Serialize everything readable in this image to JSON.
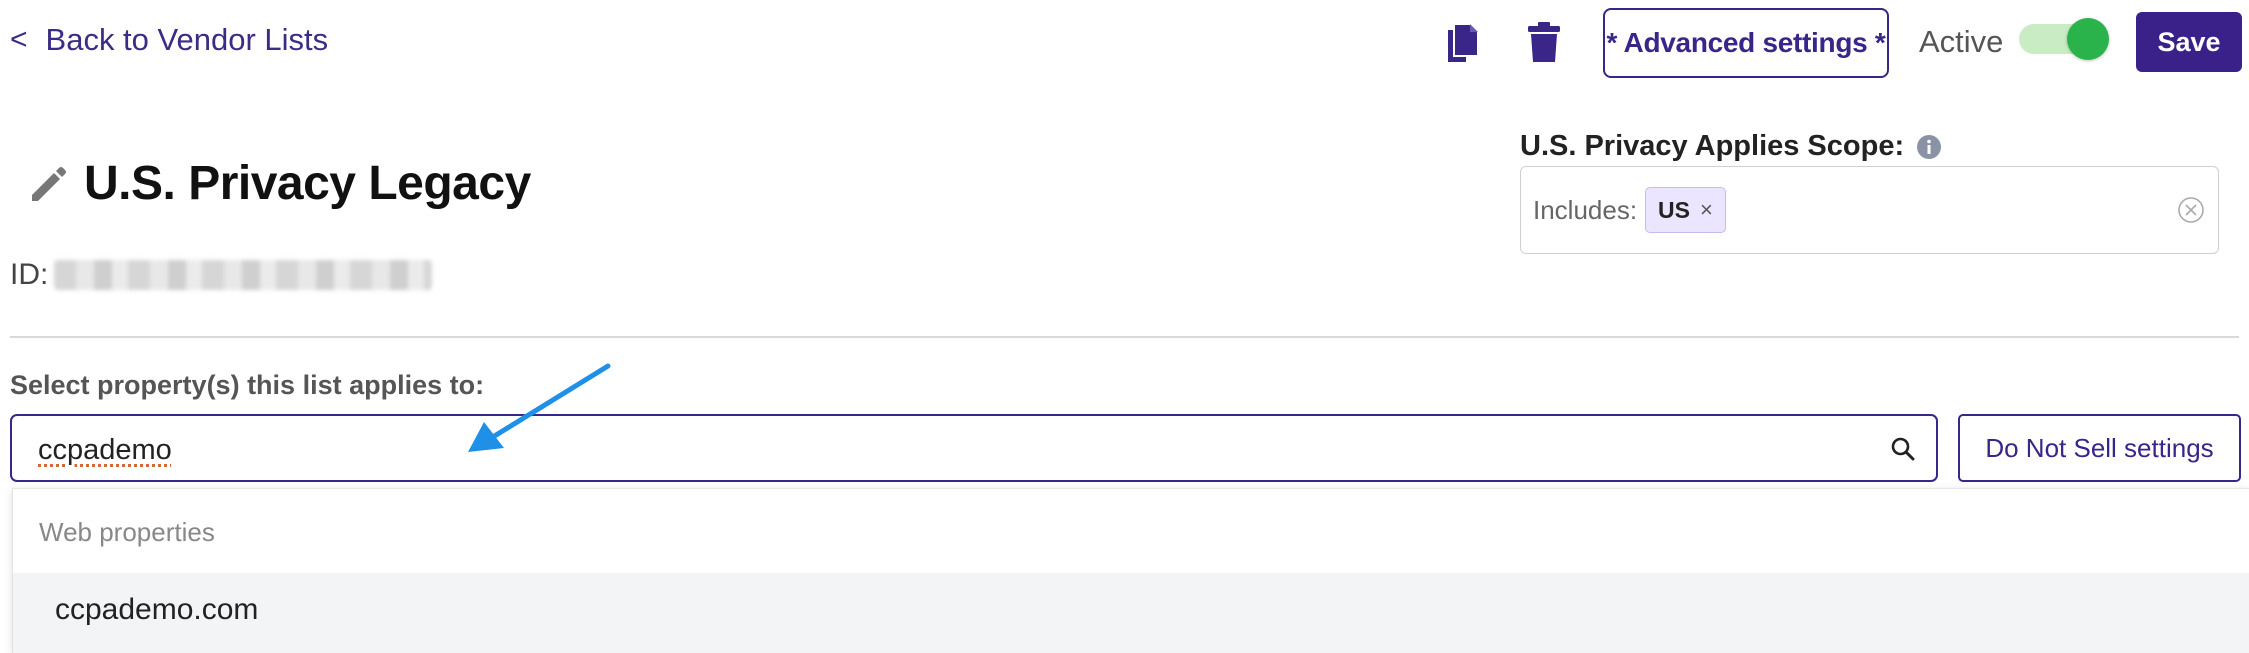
{
  "header": {
    "back_chevron": "<",
    "back_label": "Back to Vendor Lists",
    "copy_icon": "copy-icon",
    "trash_icon": "trash-icon",
    "advanced_settings_label": "* Advanced settings *",
    "active_label": "Active",
    "active_on": true,
    "save_label": "Save"
  },
  "title": {
    "icon": "pencil-icon",
    "text": "U.S. Privacy Legacy",
    "id_label": "ID:"
  },
  "scope": {
    "label": "U.S. Privacy Applies Scope:",
    "includes_label": "Includes:",
    "tags": [
      {
        "label": "US",
        "remove_glyph": "×"
      }
    ]
  },
  "properties": {
    "label": "Select property(s) this list applies to:",
    "search_value": "ccpademo",
    "do_not_sell_label": "Do Not Sell settings",
    "dropdown": {
      "group_label": "Web properties",
      "items": [
        {
          "label": "ccpademo.com"
        }
      ]
    }
  },
  "colors": {
    "brand": "#3a2189",
    "toggle_on": "#29b34a",
    "annotation_arrow": "#1e90e8"
  }
}
